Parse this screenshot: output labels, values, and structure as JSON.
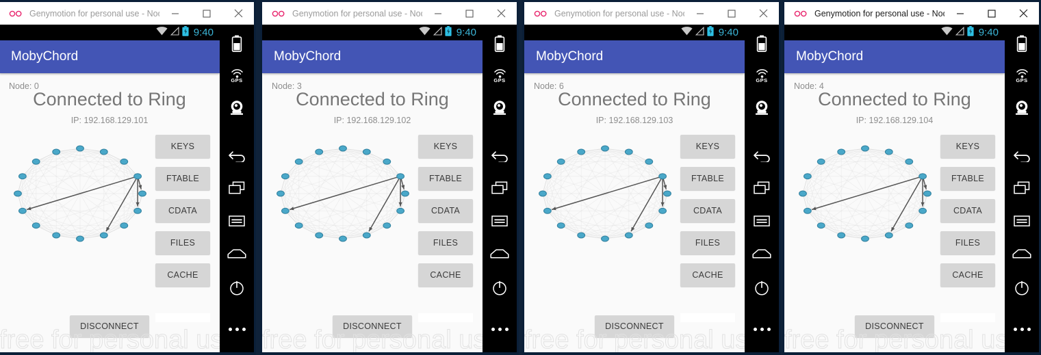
{
  "windows": [
    {
      "titlebar": {
        "title": "Genymotion for personal use - Nod...",
        "logo": "genymotion-logo",
        "minimize": "minimize-icon",
        "maximize": "maximize-icon",
        "close": "close-icon"
      },
      "active": false,
      "status": {
        "time": "9:40",
        "wifi": "wifi-icon",
        "signal": "signal-icon",
        "battery": "battery-charging-icon"
      },
      "app": {
        "title": "MobyChord"
      },
      "node": {
        "label": "Node: 0",
        "headline": "Connected to Ring",
        "ip": "IP: 192.168.129.101"
      },
      "buttons": [
        "KEYS",
        "FTABLE",
        "CDATA",
        "FILES",
        "CACHE"
      ],
      "disconnect": "DISCONNECT",
      "watermark": "free for personal use"
    },
    {
      "titlebar": {
        "title": "Genymotion for personal use - Node ...",
        "logo": "genymotion-logo",
        "minimize": "minimize-icon",
        "maximize": "maximize-icon",
        "close": "close-icon"
      },
      "active": false,
      "status": {
        "time": "9:40",
        "wifi": "wifi-icon",
        "signal": "signal-icon",
        "battery": "battery-charging-icon"
      },
      "app": {
        "title": "MobyChord"
      },
      "node": {
        "label": "Node: 3",
        "headline": "Connected to Ring",
        "ip": "IP: 192.168.129.102"
      },
      "buttons": [
        "KEYS",
        "FTABLE",
        "CDATA",
        "FILES",
        "CACHE"
      ],
      "disconnect": "DISCONNECT",
      "watermark": "free for personal use"
    },
    {
      "titlebar": {
        "title": "Genymotion for personal use - Nod...",
        "logo": "genymotion-logo",
        "minimize": "minimize-icon",
        "maximize": "maximize-icon",
        "close": "close-icon"
      },
      "active": false,
      "status": {
        "time": "9:40",
        "wifi": "wifi-icon",
        "signal": "signal-icon",
        "battery": "battery-charging-icon"
      },
      "app": {
        "title": "MobyChord"
      },
      "node": {
        "label": "Node: 6",
        "headline": "Connected to Ring",
        "ip": "IP: 192.168.129.103"
      },
      "buttons": [
        "KEYS",
        "FTABLE",
        "CDATA",
        "FILES",
        "CACHE"
      ],
      "disconnect": "DISCONNECT",
      "watermark": "free for personal use"
    },
    {
      "titlebar": {
        "title": "Genymotion for personal use - Nod...",
        "logo": "genymotion-logo",
        "minimize": "minimize-icon",
        "maximize": "maximize-icon",
        "close": "close-icon"
      },
      "active": true,
      "status": {
        "time": "9:40",
        "wifi": "wifi-icon",
        "signal": "signal-icon",
        "battery": "battery-charging-icon"
      },
      "app": {
        "title": "MobyChord"
      },
      "node": {
        "label": "Node: 4",
        "headline": "Connected to Ring",
        "ip": "IP: 192.168.129.104"
      },
      "buttons": [
        "KEYS",
        "FTABLE",
        "CDATA",
        "FILES",
        "CACHE"
      ],
      "disconnect": "DISCONNECT",
      "watermark": "free for personal use"
    }
  ],
  "genymotion_toolbar": {
    "items": [
      {
        "name": "battery-icon"
      },
      {
        "name": "gps-icon",
        "label": "GPS"
      },
      {
        "name": "camera-icon"
      },
      {
        "name": "back-icon"
      },
      {
        "name": "recents-icon"
      },
      {
        "name": "menu-icon"
      },
      {
        "name": "home-icon"
      },
      {
        "name": "power-icon"
      },
      {
        "name": "more-icon"
      }
    ]
  },
  "ring_graph": {
    "node_count": 16,
    "node_color": "#4aa8c9",
    "node_stroke": "#2f7f9d",
    "chord_color": "#d9d9d9",
    "finger_color": "#555555",
    "active_node_index": 3,
    "finger_targets": [
      4,
      5,
      7,
      11
    ]
  },
  "colors": {
    "appbar": "#4355b5",
    "desktop": "#0f2239",
    "status_time": "#3bb6d8",
    "button_bg": "#d6d6d6",
    "screen_bg": "#fafafa"
  }
}
